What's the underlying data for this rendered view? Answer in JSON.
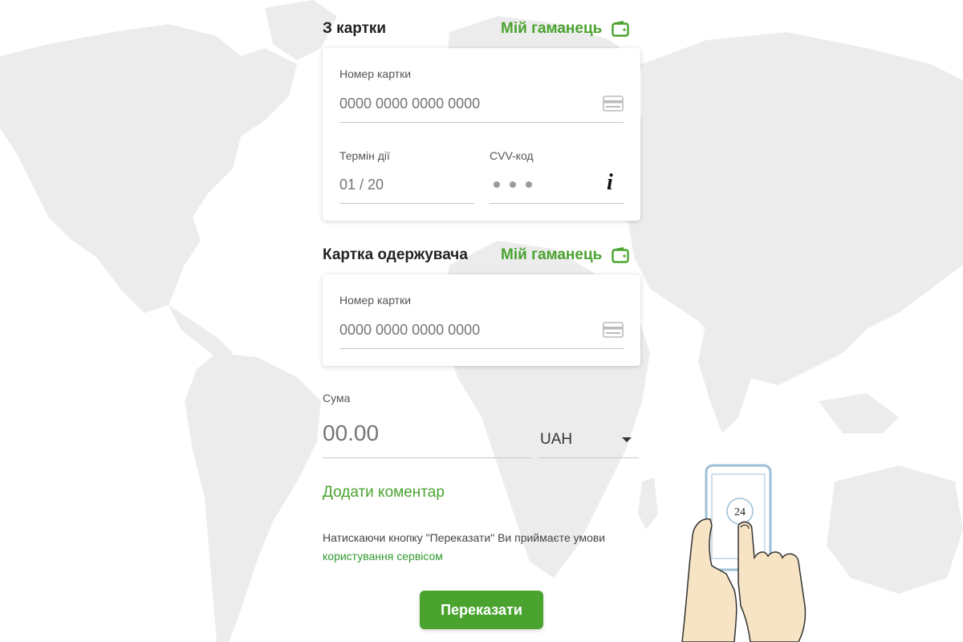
{
  "from_card": {
    "title": "З картки",
    "wallet_label": "Мій гаманець",
    "card_number_label": "Номер картки",
    "card_number_placeholder": "0000 0000 0000 0000",
    "expiry_label": "Термін дії",
    "expiry_placeholder": "01 / 20",
    "cvv_label": "CVV-код",
    "info_icon": "i"
  },
  "to_card": {
    "title": "Картка одержувача",
    "wallet_label": "Мій гаманець",
    "card_number_label": "Номер картки",
    "card_number_placeholder": "0000 0000 0000 0000"
  },
  "amount": {
    "label": "Сума",
    "placeholder": "00.00",
    "currency": "UAH"
  },
  "comment_link": "Додати коментар",
  "terms": {
    "text": "Натискаючи кнопку \"Переказати\" Ви приймаєте умови ",
    "link": "користування сервісом"
  },
  "submit_label": "Переказати",
  "illustration": {
    "phone_badge": "24"
  },
  "colors": {
    "accent": "#4aa32f",
    "map": "#ececec"
  },
  "icons": {
    "wallet": "wallet-icon",
    "card": "credit-card-icon",
    "info": "info-icon",
    "dropdown": "caret-down-icon"
  }
}
